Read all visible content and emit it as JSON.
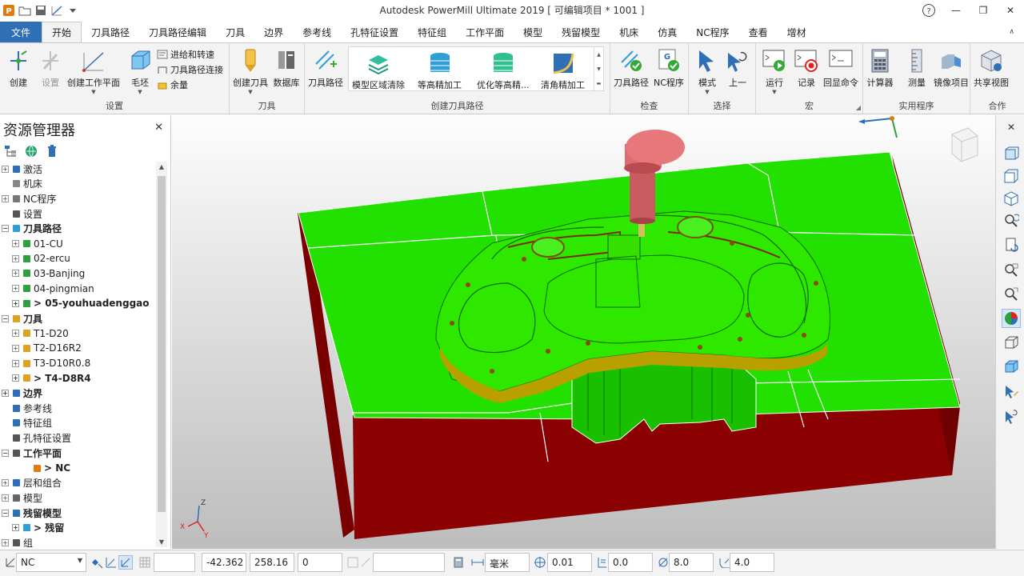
{
  "window": {
    "title": "Autodesk PowerMill Ultimate 2019   [ 可编辑项目 * 1001 ]",
    "help": "?",
    "minimize": "—",
    "restore": "❐",
    "close": "✕"
  },
  "tabs": [
    "文件",
    "开始",
    "刀具路径",
    "刀具路径编辑",
    "刀具",
    "边界",
    "参考线",
    "孔特征设置",
    "特征组",
    "工作平面",
    "模型",
    "残留模型",
    "机床",
    "仿真",
    "NC程序",
    "查看",
    "增材"
  ],
  "active_tab": "开始",
  "ribbon": {
    "groups": {
      "setup": "设置",
      "tool": "刀具",
      "create_toolpath": "创建刀具路径",
      "verify": "检查",
      "select": "选择",
      "macro": "宏",
      "utilities": "实用程序",
      "collab": "合作"
    },
    "buttons": {
      "create": "创建",
      "settings": "设置",
      "create_workplane": "创建工作平面",
      "block": "毛坯",
      "leads_links": "进给和转速",
      "toolpath_connect": "刀具路径连接",
      "allowance": "余量",
      "create_tool": "创建刀具",
      "database": "数据库",
      "toolpath": "刀具路径",
      "model_area_clear": "模型区域清除",
      "constant_z": "等高精加工",
      "opt_constant_z": "优化等高精...",
      "corner_finish": "清角精加工",
      "verify_toolpath": "刀具路径",
      "verify_nc": "NC程序",
      "mode": "模式",
      "previous": "上一",
      "run": "运行",
      "record": "记录",
      "echo": "回显命令",
      "calculator": "计算器",
      "measure": "测量",
      "mirror": "镜像项目",
      "share_view": "共享视图"
    }
  },
  "explorer": {
    "title": "资源管理器",
    "close": "✕",
    "tree": [
      {
        "label": "激活",
        "bold": false,
        "indent": 0,
        "exp": "+"
      },
      {
        "label": "机床",
        "bold": false,
        "indent": 0,
        "exp": ""
      },
      {
        "label": "NC程序",
        "bold": false,
        "indent": 0,
        "exp": "+"
      },
      {
        "label": "设置",
        "bold": false,
        "indent": 0,
        "exp": ""
      },
      {
        "label": "刀具路径",
        "bold": true,
        "indent": 0,
        "exp": "−"
      },
      {
        "label": "01-CU",
        "bold": false,
        "indent": 1,
        "exp": "+"
      },
      {
        "label": "02-ercu",
        "bold": false,
        "indent": 1,
        "exp": "+"
      },
      {
        "label": "03-Banjing",
        "bold": false,
        "indent": 1,
        "exp": "+"
      },
      {
        "label": "04-pingmian",
        "bold": false,
        "indent": 1,
        "exp": "+"
      },
      {
        "label": "> 05-youhuadenggao",
        "bold": true,
        "indent": 1,
        "exp": "+"
      },
      {
        "label": "刀具",
        "bold": true,
        "indent": 0,
        "exp": "−"
      },
      {
        "label": "T1-D20",
        "bold": false,
        "indent": 1,
        "exp": "+"
      },
      {
        "label": "T2-D16R2",
        "bold": false,
        "indent": 1,
        "exp": "+"
      },
      {
        "label": "T3-D10R0.8",
        "bold": false,
        "indent": 1,
        "exp": "+"
      },
      {
        "label": "> T4-D8R4",
        "bold": true,
        "indent": 1,
        "exp": "+"
      },
      {
        "label": "边界",
        "bold": true,
        "indent": 0,
        "exp": "+"
      },
      {
        "label": "参考线",
        "bold": false,
        "indent": 0,
        "exp": ""
      },
      {
        "label": "特征组",
        "bold": false,
        "indent": 0,
        "exp": ""
      },
      {
        "label": "孔特征设置",
        "bold": false,
        "indent": 0,
        "exp": ""
      },
      {
        "label": "工作平面",
        "bold": true,
        "indent": 0,
        "exp": "−"
      },
      {
        "label": "> NC",
        "bold": true,
        "indent": 2,
        "exp": ""
      },
      {
        "label": "层和组合",
        "bold": false,
        "indent": 0,
        "exp": "+"
      },
      {
        "label": "模型",
        "bold": false,
        "indent": 0,
        "exp": "+"
      },
      {
        "label": "残留模型",
        "bold": true,
        "indent": 0,
        "exp": "−"
      },
      {
        "label": "> 残留",
        "bold": true,
        "indent": 1,
        "exp": "+"
      },
      {
        "label": "组",
        "bold": false,
        "indent": 0,
        "exp": "+"
      }
    ]
  },
  "viewport": {
    "axis_labels": {
      "x": "X",
      "y": "Y",
      "z": "Z"
    }
  },
  "status": {
    "workplane": "NC",
    "coord_x": "-42.362",
    "coord_y": "258.16",
    "coord_z": "0",
    "units": "毫米",
    "tolerance": "0.01",
    "thickness": "0.0",
    "tool_diameter": "8.0",
    "tip_radius": "4.0"
  },
  "colors": {
    "accent": "#2f6fb6",
    "model_green": "#22e000",
    "model_red": "#8b0000",
    "tool_holder": "#e06b6f",
    "tool_tip": "#d4c060"
  }
}
